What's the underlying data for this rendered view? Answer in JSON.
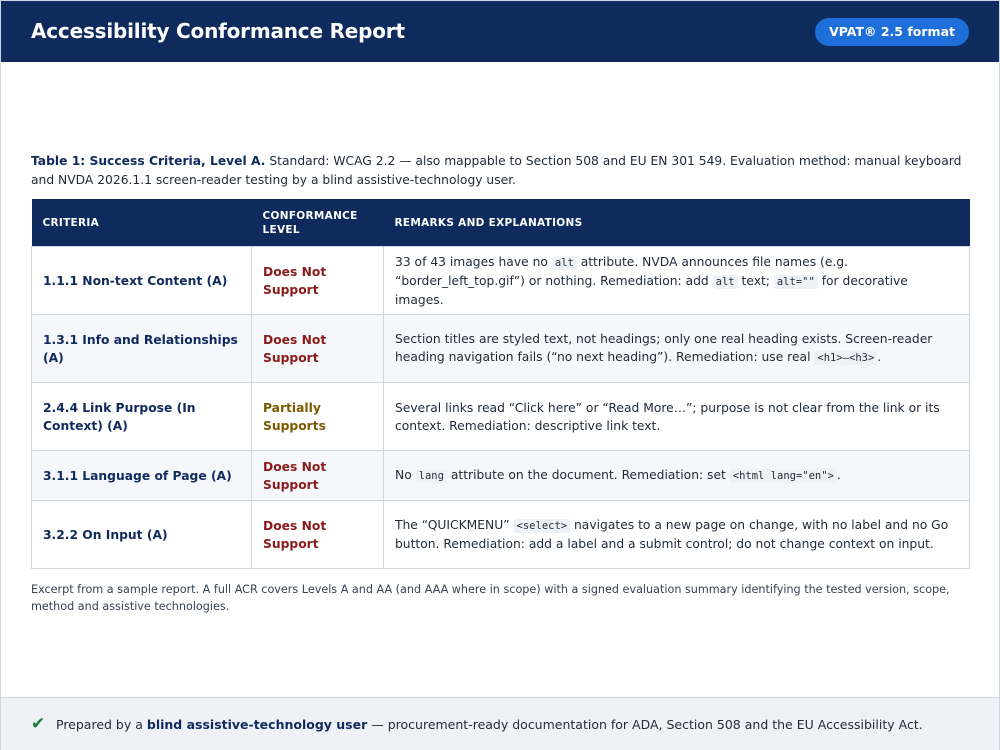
{
  "header": {
    "title": "Accessibility Conformance Report",
    "badge": "VPAT® 2.5 format"
  },
  "caption": {
    "label": "Table 1: Success Criteria, Level A.",
    "text": " Standard: WCAG 2.2 — also mappable to Section 508 and EU EN 301 549. Evaluation method: manual keyboard and NVDA 2026.1.1 screen-reader testing by a blind assistive-technology user."
  },
  "table": {
    "headers": {
      "criteria": "Criteria",
      "level": "Conformance Level",
      "remarks": "Remarks and Explanations"
    },
    "rows": [
      {
        "criteria": "1.1.1 Non-text Content (A)",
        "level": "Does Not Support",
        "r": {
          "a": "33 of 43 images have no ",
          "c1": "alt",
          "b": " attribute. NVDA announces file names (e.g. “border_left_top.gif”) or nothing. Remediation: add ",
          "c2": "alt",
          "c": " text; ",
          "c3": "alt=\"\"",
          "d": " for decorative images."
        }
      },
      {
        "criteria": "1.3.1 Info and Relationships (A)",
        "level": "Does Not Support",
        "r": {
          "a": "Section titles are styled text, not headings; only one real heading exists. Screen-reader heading navigation fails (“no next heading”). Remediation: use real ",
          "c1": "<h1>–<h3>",
          "b": "."
        }
      },
      {
        "criteria": "2.4.4 Link Purpose (In Context) (A)",
        "level": "Partially Supports",
        "r": {
          "a": "Several links read “Click here” or “Read More…”; purpose is not clear from the link or its context. Remediation: descriptive link text."
        }
      },
      {
        "criteria": "3.1.1 Language of Page (A)",
        "level": "Does Not Support",
        "r": {
          "a": "No ",
          "c1": "lang",
          "b": " attribute on the document. Remediation: set ",
          "c2": "<html lang=\"en\">",
          "c": "."
        }
      },
      {
        "criteria": "3.2.2 On Input (A)",
        "level": "Does Not Support",
        "r": {
          "a": "The “QUICKMENU” ",
          "c1": "<select>",
          "b": " navigates to a new page on change, with no label and no Go button. Remediation: add a label and a submit control; do not change context on input."
        }
      }
    ]
  },
  "note": "Excerpt from a sample report. A full ACR covers Levels A and AA (and AAA where in scope) with a signed evaluation summary identifying the tested version, scope, method and assistive technologies.",
  "footer": {
    "icon": "check-icon",
    "prefix": "Prepared by a ",
    "strong": "blind assistive-technology user",
    "suffix": " — procurement-ready documentation for ADA, Section 508 and the EU Accessibility Act."
  },
  "colors": {
    "navy": "#0f2a5c",
    "badge_blue": "#1e6fd9",
    "does_not_support": "#8b1a1a",
    "partially_supports": "#7a5a00",
    "check_green": "#1e7a3a"
  }
}
